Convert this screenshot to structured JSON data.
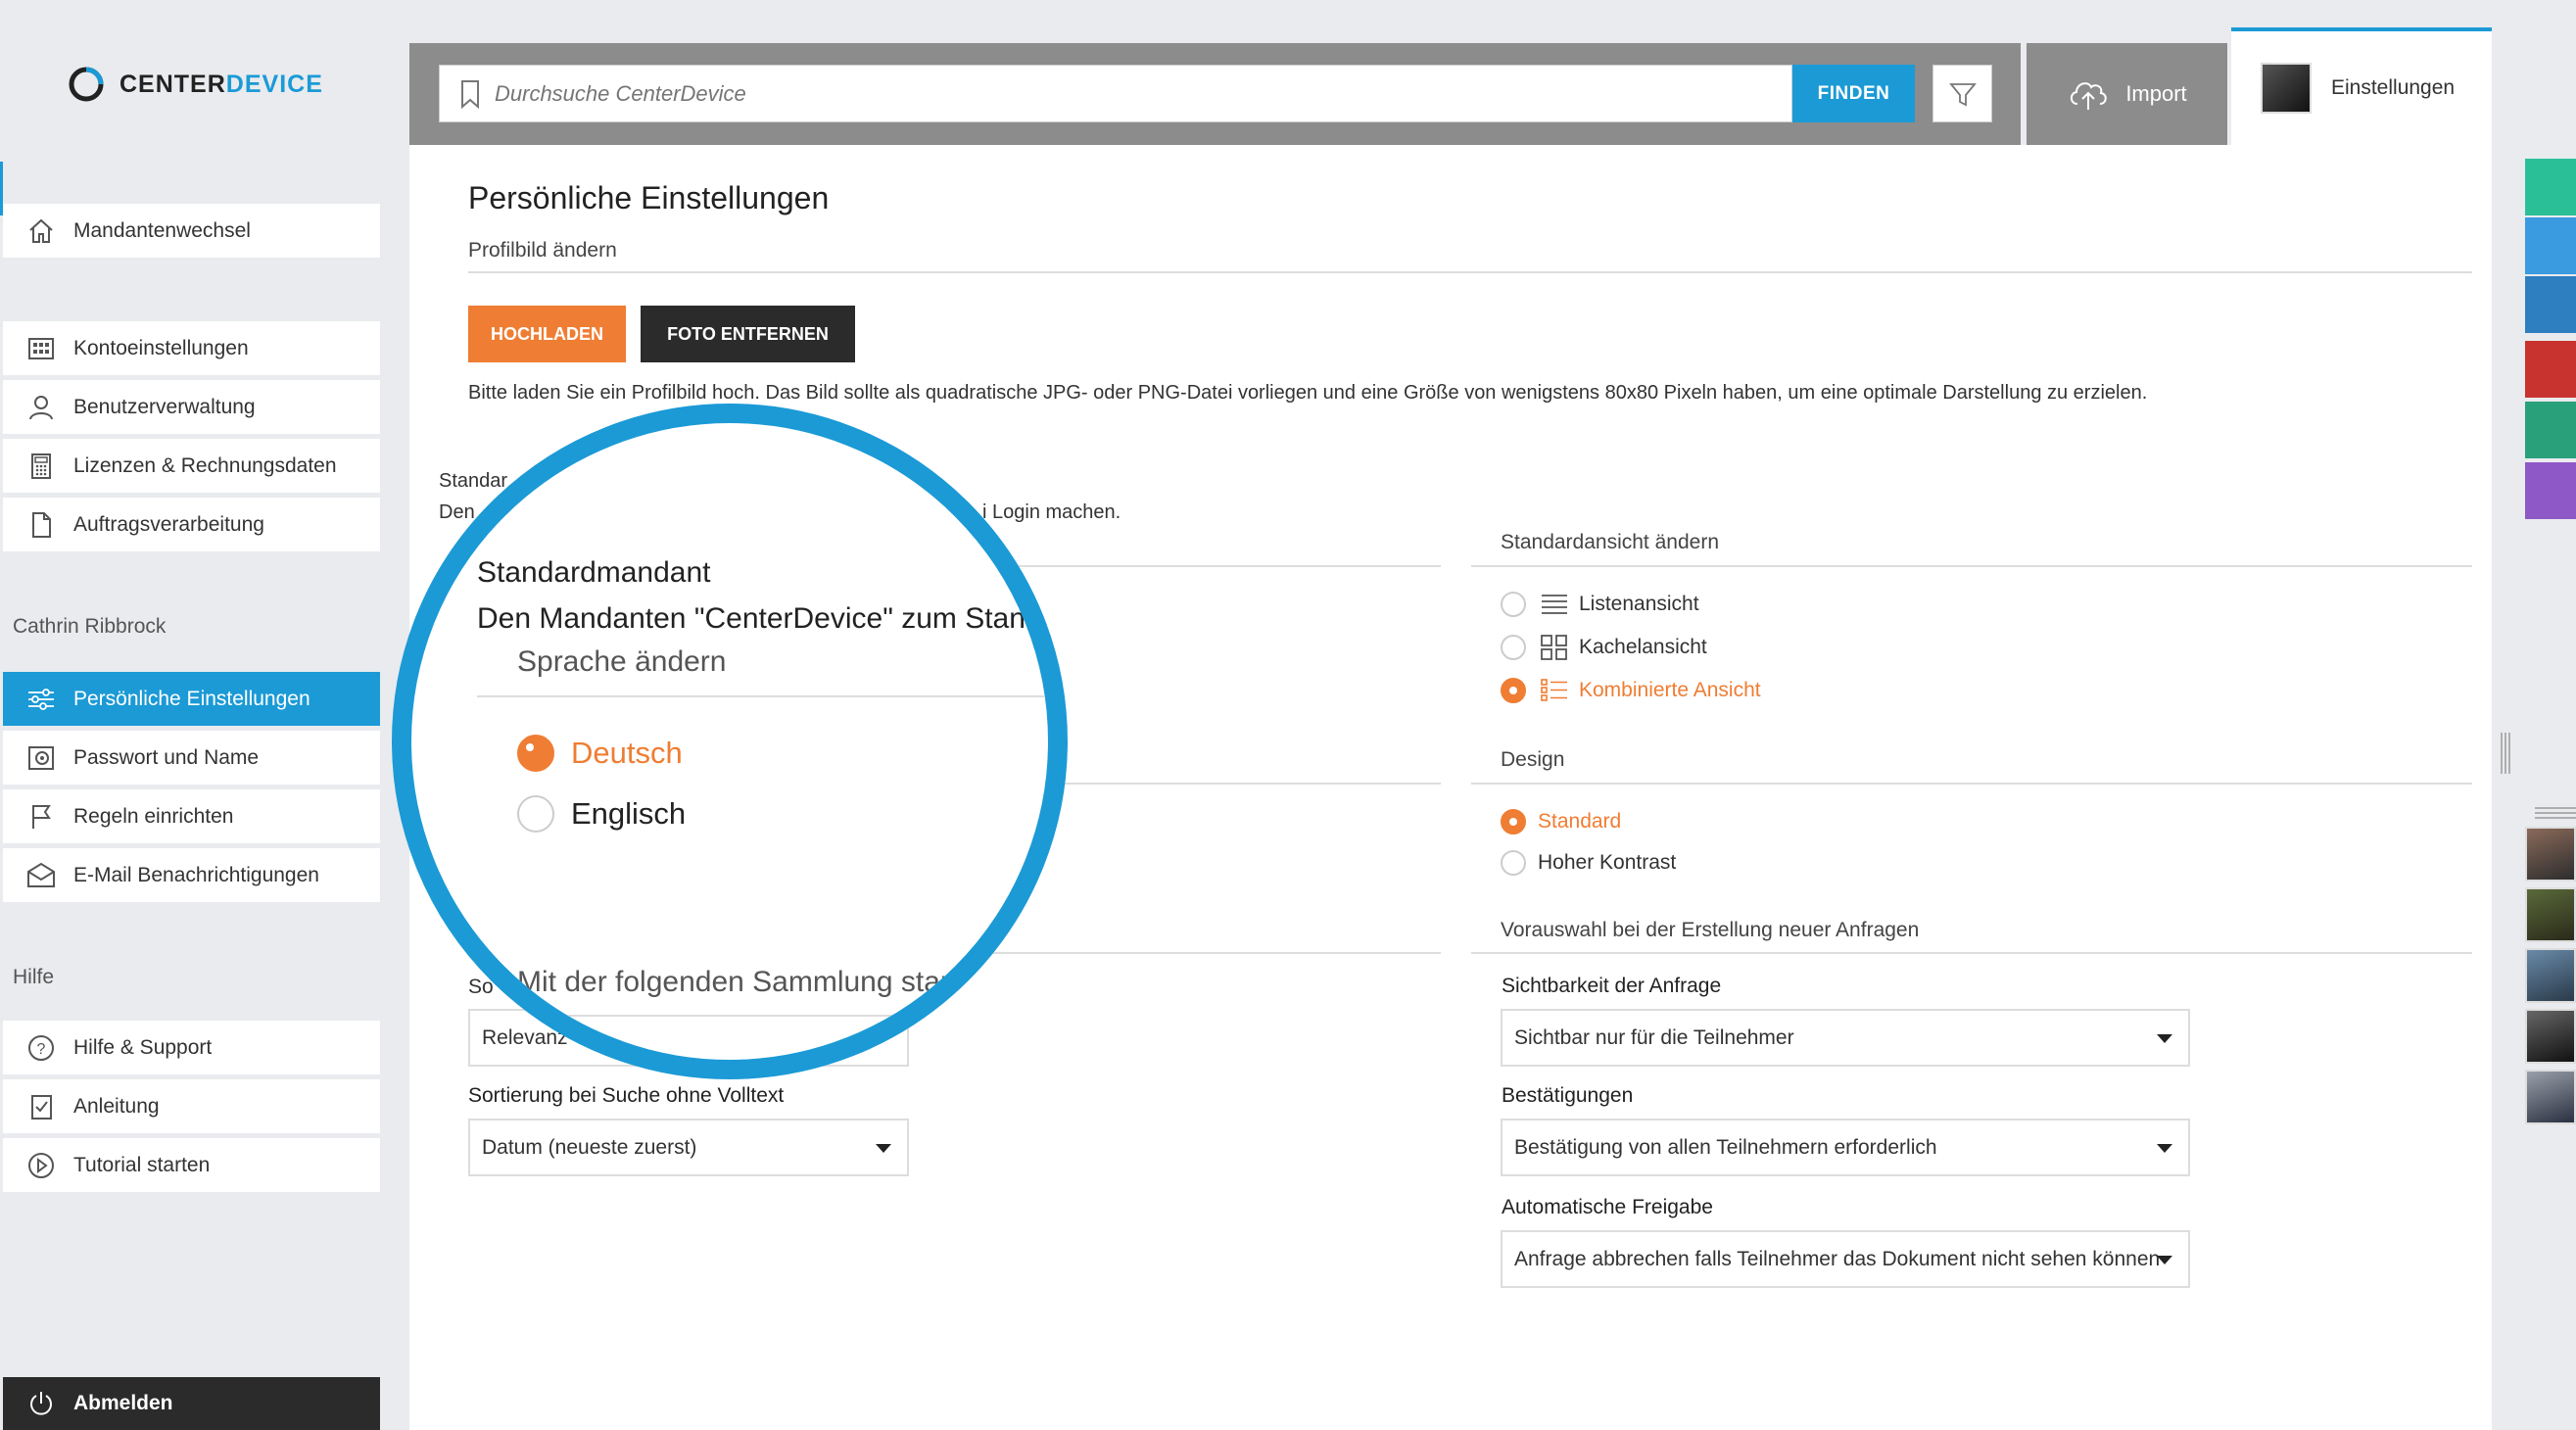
{
  "logo": {
    "text_main": "CENTER",
    "text_accent": "DEVICE"
  },
  "sidebar": {
    "items_top": [
      {
        "label": "Mandantenwechsel",
        "icon": "home-icon"
      }
    ],
    "items_account": [
      {
        "label": "Kontoeinstellungen",
        "icon": "grid-icon"
      },
      {
        "label": "Benutzerverwaltung",
        "icon": "user-icon"
      },
      {
        "label": "Lizenzen & Rechnungsdaten",
        "icon": "calculator-icon"
      },
      {
        "label": "Auftragsverarbeitung",
        "icon": "document-icon"
      }
    ],
    "user_heading": "Cathrin Ribbrock",
    "items_user": [
      {
        "label": "Persönliche Einstellungen",
        "icon": "sliders-icon"
      },
      {
        "label": "Passwort und Name",
        "icon": "safe-icon"
      },
      {
        "label": "Regeln einrichten",
        "icon": "flag-icon"
      },
      {
        "label": "E-Mail Benachrichtigungen",
        "icon": "mail-icon"
      }
    ],
    "help_heading": "Hilfe",
    "items_help": [
      {
        "label": "Hilfe & Support",
        "icon": "question-icon"
      },
      {
        "label": "Anleitung",
        "icon": "checklist-icon"
      },
      {
        "label": "Tutorial starten",
        "icon": "play-icon"
      }
    ],
    "logout_label": "Abmelden"
  },
  "topbar": {
    "search_placeholder": "Durchsuche CenterDevice",
    "find_label": "FINDEN",
    "import_label": "Import",
    "settings_label": "Einstellungen"
  },
  "main": {
    "title": "Persönliche Einstellungen",
    "profile_heading": "Profilbild ändern",
    "upload_label": "HOCHLADEN",
    "remove_photo_label": "FOTO ENTFERNEN",
    "profile_hint": "Bitte laden Sie ein Profilbild hoch. Das Bild sollte als quadratische JPG- oder PNG-Datei vorliegen und eine Größe von wenigstens 80x80 Pixeln haben, um eine optimale Darstellung zu erzielen.",
    "default_tenant_partial": "Standar",
    "default_tenant_line_partial_start": "Den",
    "default_tenant_line_partial_end": "i Login machen.",
    "view_heading": "Standardansicht ändern",
    "view_options": [
      {
        "label": "Listenansicht",
        "icon": "list-icon",
        "selected": false
      },
      {
        "label": "Kachelansicht",
        "icon": "tiles-icon",
        "selected": false
      },
      {
        "label": "Kombinierte Ansicht",
        "icon": "combined-list-icon",
        "selected": true
      }
    ],
    "design_heading": "Design",
    "design_options": [
      {
        "label": "Standard",
        "selected": true
      },
      {
        "label": "Hoher Kontrast",
        "selected": false
      }
    ],
    "requests_heading": "Vorauswahl bei der Erstellung neuer Anfragen",
    "visibility_label": "Sichtbarkeit der Anfrage",
    "visibility_value": "Sichtbar nur für die Teilnehmer",
    "confirmations_label": "Bestätigungen",
    "confirmations_value": "Bestätigung von allen Teilnehmern erforderlich",
    "auto_release_label": "Automatische Freigabe",
    "auto_release_value": "Anfrage abbrechen falls Teilnehmer das Dokument nicht sehen können",
    "sort_label_partial": "So",
    "sort_relevance_value": "Relevanz",
    "sort_no_fulltext_label": "Sortierung bei Suche ohne Volltext",
    "sort_no_fulltext_value": "Datum (neueste zuerst)"
  },
  "magnifier": {
    "default_tenant_heading": "Standardmandant",
    "default_tenant_text": "Den Mandanten \"CenterDevice\" zum Stand",
    "language_heading": "Sprache ändern",
    "language_options": [
      {
        "label": "Deutsch",
        "selected": true
      },
      {
        "label": "Englisch",
        "selected": false
      }
    ],
    "collection_text": "Mit der folgenden Sammlung start"
  },
  "colors": {
    "accent_blue": "#1b9ad6",
    "accent_orange": "#ef7d33",
    "right_tabs": [
      "#2bbf98",
      "#3a9be0",
      "#2e7fc0",
      "#c8322f",
      "#29a07a",
      "#8e58c6"
    ]
  }
}
